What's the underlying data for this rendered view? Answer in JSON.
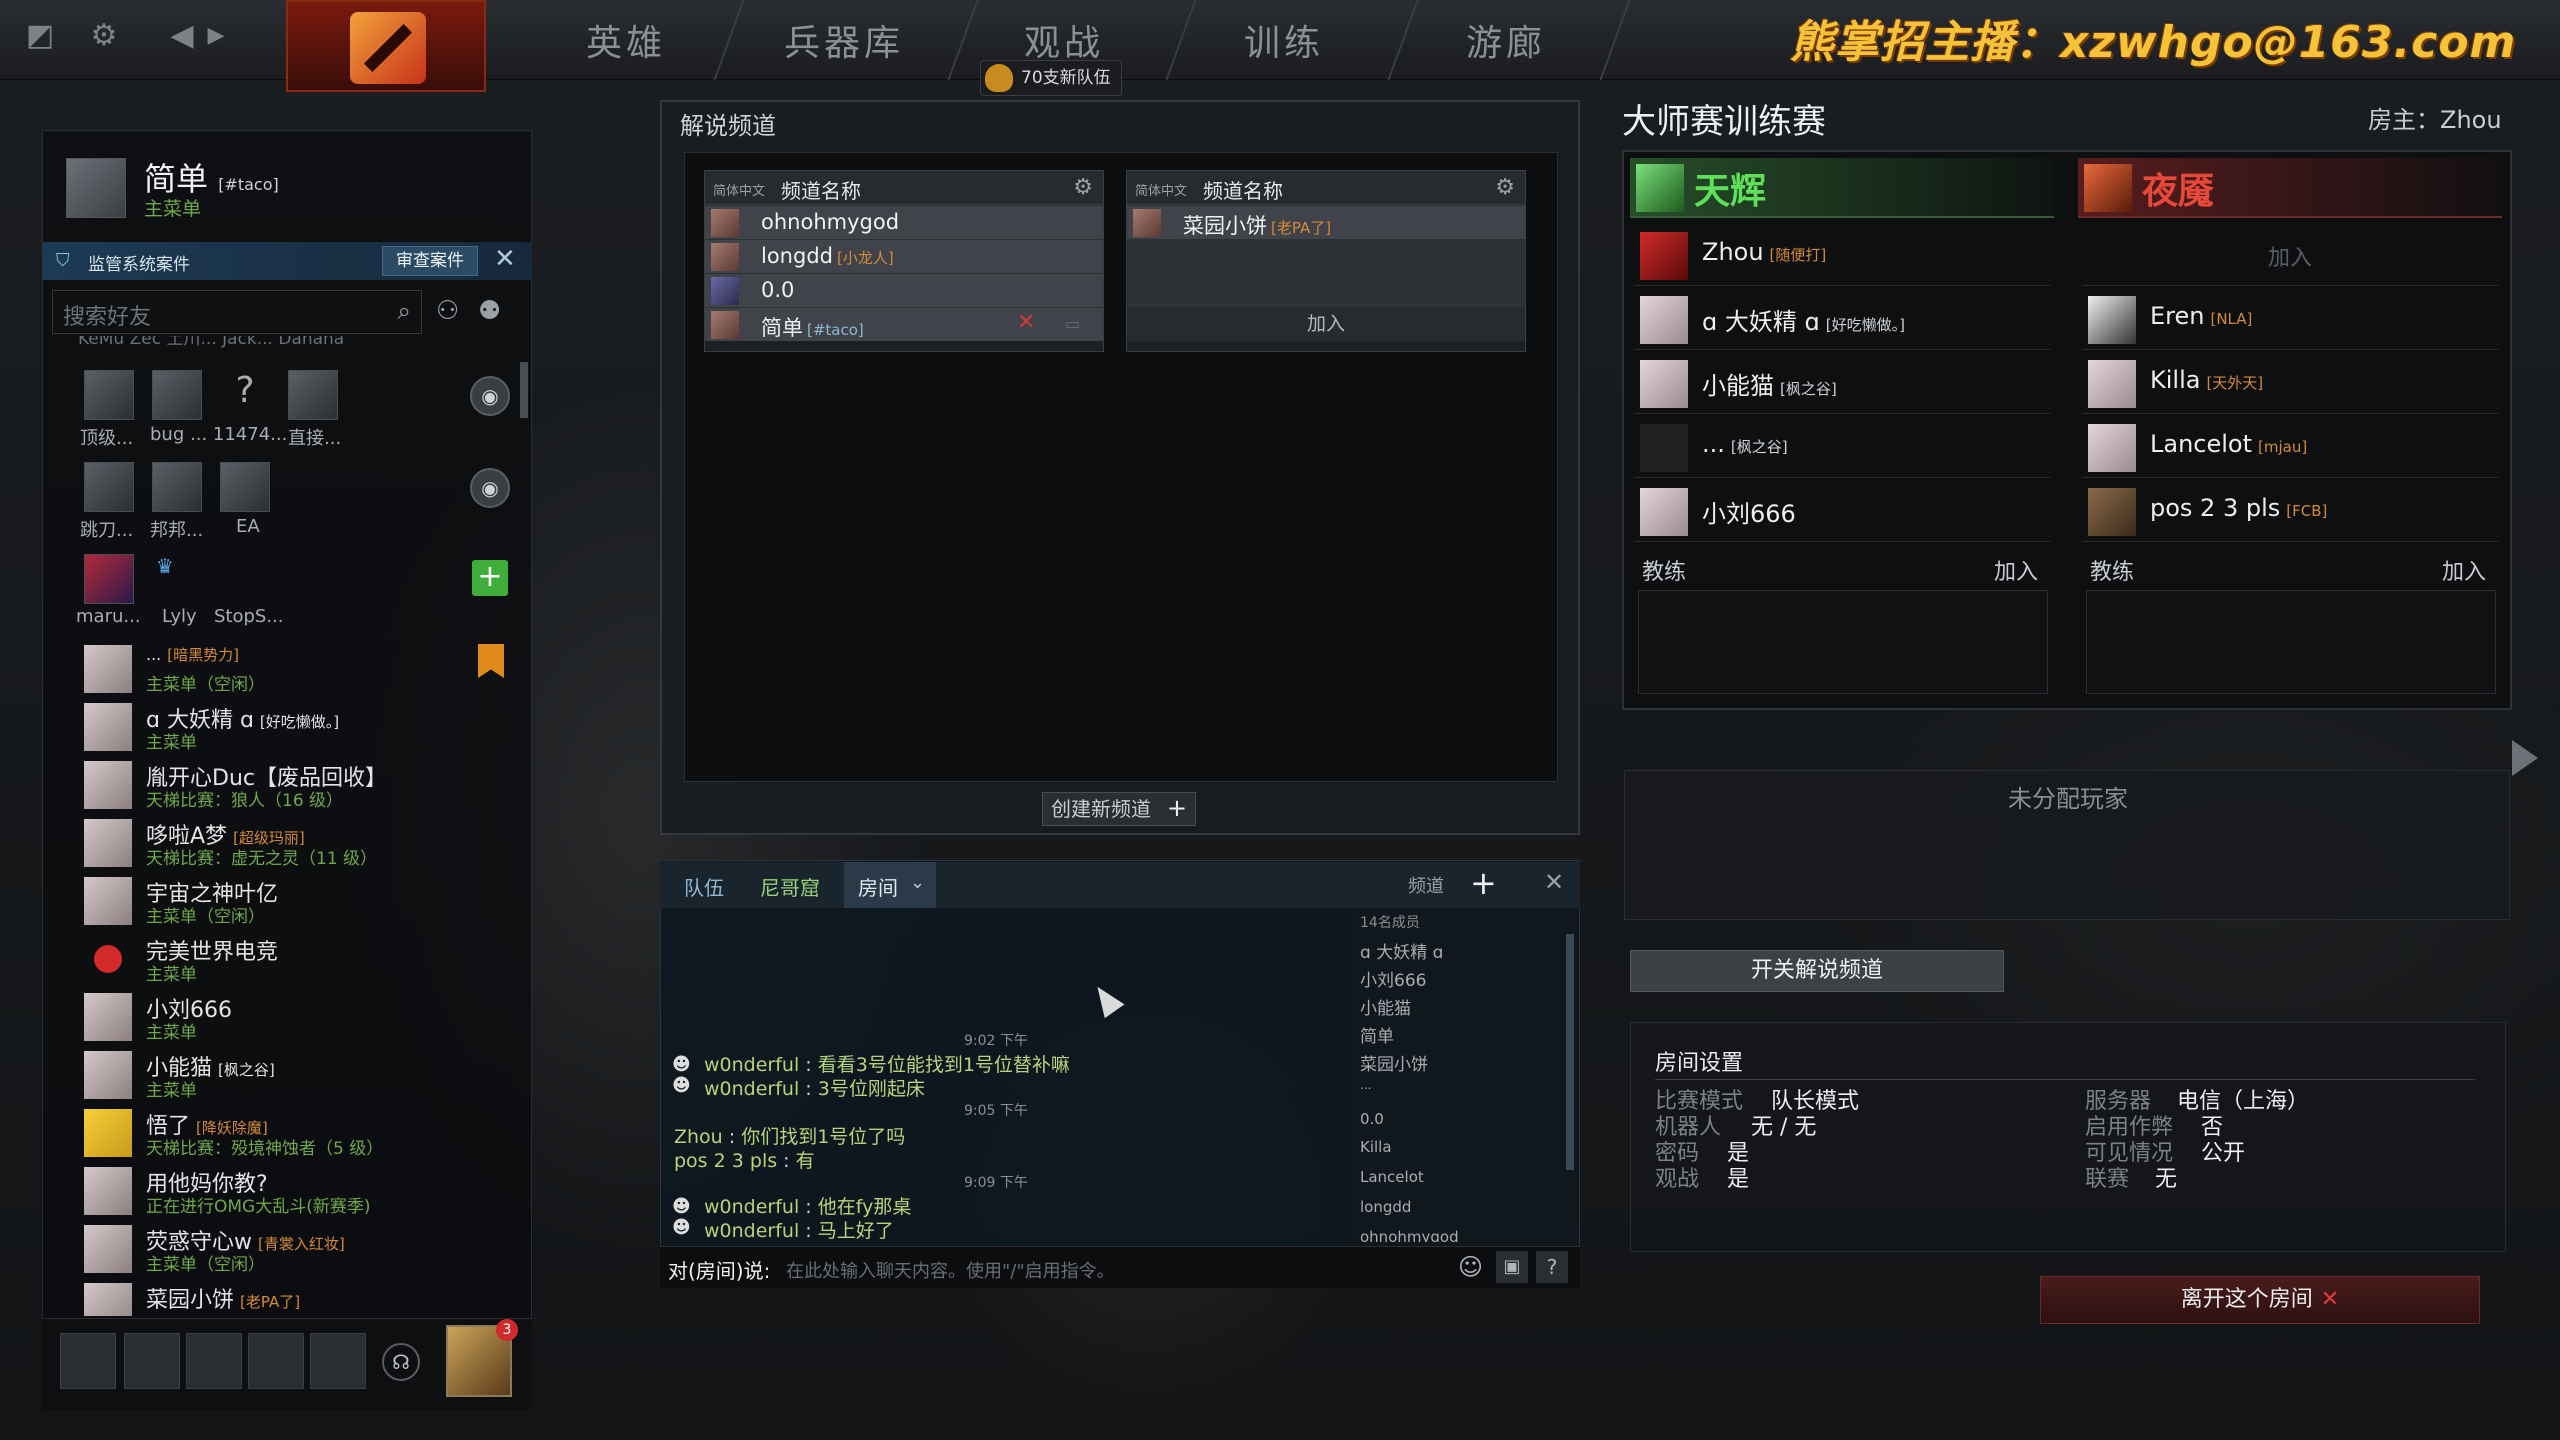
{
  "topbar": {
    "nav": [
      "英雄",
      "兵器库",
      "观战",
      "训练",
      "游廊"
    ],
    "new_teams_badge": "70支新队伍",
    "watermark": "熊掌招主播：xzwhgo@163.com"
  },
  "left": {
    "profile": {
      "name": "简单",
      "tag": "[#taco]",
      "status": "主菜单"
    },
    "case_bar": {
      "label": "监管系统案件",
      "review_button": "审查案件"
    },
    "search_placeholder": "搜索好友",
    "cut_off_row": "KeMu   Zec   土川...  Jack...  Danana",
    "groups": [
      {
        "labels": [
          "顶级...",
          "bug",
          "... 11474...",
          "直接..."
        ]
      },
      {
        "labels": [
          "跳刀...",
          "邦邦...",
          "EA"
        ]
      },
      {
        "labels": [
          "maru...",
          "Lyly",
          "StopS..."
        ]
      }
    ],
    "friends": [
      {
        "name": "...",
        "tag": "[暗黑势力]",
        "status": "主菜单（空闲）",
        "status_color": "#6fa84a"
      },
      {
        "name": "ɑ 大妖精 ɑ",
        "tag": "[好吃懒做。]",
        "status": "主菜单",
        "status_color": "#6fa84a"
      },
      {
        "name": "胤开心Duc【废品回收】",
        "tag": "",
        "status": "天梯比赛：狼人（16 级）",
        "status_color": "#6fa84a"
      },
      {
        "name": "哆啦A梦",
        "tag": "[超级玛丽]",
        "status": "天梯比赛：虚无之灵（11 级）",
        "status_color": "#6fa84a"
      },
      {
        "name": "宇宙之神叶亿",
        "tag": "",
        "status": "主菜单（空闲）",
        "status_color": "#6fa84a"
      },
      {
        "name": "完美世界电竞",
        "tag": "",
        "status": "主菜单",
        "status_color": "#6fa84a"
      },
      {
        "name": "小刘666",
        "tag": "",
        "status": "主菜单",
        "status_color": "#6fa84a"
      },
      {
        "name": "小能猫",
        "tag": "[枫之谷]",
        "status": "主菜单",
        "status_color": "#6fa84a"
      },
      {
        "name": "悟了",
        "tag": "[降妖除魔]",
        "status": "天梯比赛：殁境神蚀者（5 级）",
        "status_color": "#6fa84a"
      },
      {
        "name": "用他妈你教?",
        "tag": "",
        "status": "正在进行OMG大乱斗(新赛季)",
        "status_color": "#6fa84a"
      },
      {
        "name": "荧惑守心w",
        "tag": "[青裳入红妆]",
        "status": "主菜单（空闲）",
        "status_color": "#6fa84a"
      },
      {
        "name": "菜园小饼",
        "tag": "[老PA了]",
        "status": "",
        "status_color": "#6fa84a"
      }
    ],
    "notification_count": "3"
  },
  "broadcast": {
    "title": "解说频道",
    "channels": [
      {
        "lang": "简体中文",
        "name": "频道名称",
        "members": [
          {
            "name": "ohnohmygod",
            "tag": ""
          },
          {
            "name": "longdd",
            "tag": "[小龙人]"
          },
          {
            "name": "0.0",
            "tag": ""
          },
          {
            "name": "简单",
            "tag": "[#taco]"
          }
        ]
      },
      {
        "lang": "简体中文",
        "name": "频道名称",
        "members": [
          {
            "name": "菜园小饼",
            "tag": "[老PA了]"
          }
        ],
        "join": "加入"
      }
    ],
    "new_channel": "创建新频道"
  },
  "chat": {
    "tabs": [
      "队伍",
      "尼哥窟",
      "房间"
    ],
    "channel_label": "频道",
    "member_count": "14名成员",
    "members": [
      "ɑ 大妖精 ɑ",
      "小刘666",
      "小能猫",
      "简单",
      "菜园小饼",
      "...",
      "0.0",
      "Killa",
      "Lancelot",
      "longdd",
      "ohnohmygod"
    ],
    "messages": [
      {
        "time": "9:02 下午",
        "lines": [
          {
            "name": "w0nderful",
            "text": "看看3号位能找到1号位替补嘛"
          },
          {
            "name": "w0nderful",
            "text": "3号位刚起床"
          }
        ]
      },
      {
        "time": "9:05 下午",
        "lines": [
          {
            "name": "Zhou",
            "text": "你们找到1号位了吗"
          },
          {
            "name": "pos 2 3 pls",
            "text": "有"
          }
        ]
      },
      {
        "time": "9:09 下午",
        "lines": [
          {
            "name": "w0nderful",
            "text": "他在fy那桌"
          },
          {
            "name": "w0nderful",
            "text": "马上好了"
          }
        ]
      }
    ],
    "input_prefix": "对(房间)说:",
    "input_placeholder": "在此处输入聊天内容。使用\"/\"启用指令。"
  },
  "lobby": {
    "title": "大师赛训练赛",
    "host": "房主：Zhou",
    "radiant": {
      "name": "天辉",
      "color": "#5fe05a",
      "players": [
        {
          "name": "Zhou",
          "tag": "[随便打]"
        },
        {
          "name": "ɑ 大妖精 ɑ",
          "tag": "[好吃懒做。]"
        },
        {
          "name": "小能猫",
          "tag": "[枫之谷]"
        },
        {
          "name": "...",
          "tag": "[枫之谷]"
        },
        {
          "name": "小刘666",
          "tag": ""
        }
      ]
    },
    "dire": {
      "name": "夜魇",
      "color": "#e8483a",
      "players": [
        {
          "name": "",
          "tag": "",
          "empty": "加入"
        },
        {
          "name": "Eren",
          "tag": "[NLA]"
        },
        {
          "name": "Killa",
          "tag": "[天外天]"
        },
        {
          "name": "Lancelot",
          "tag": "[mjau]"
        },
        {
          "name": "pos 2 3 pls",
          "tag": "[FCB]"
        }
      ]
    },
    "coach_label": "教练",
    "coach_join": "加入",
    "unassigned": "未分配玩家",
    "toggle_broadcast": "开关解说频道",
    "settings": {
      "title": "房间设置",
      "rows": [
        {
          "k": "比赛模式",
          "v": "队长模式"
        },
        {
          "k": "机器人",
          "v": "无 / 无"
        },
        {
          "k": "密码",
          "v": "是"
        },
        {
          "k": "观战",
          "v": "是"
        }
      ],
      "rows_right": [
        {
          "k": "服务器",
          "v": "电信（上海）"
        },
        {
          "k": "启用作弊",
          "v": "否"
        },
        {
          "k": "可见情况",
          "v": "公开"
        },
        {
          "k": "联赛",
          "v": "无"
        }
      ]
    },
    "leave": "离开这个房间"
  }
}
